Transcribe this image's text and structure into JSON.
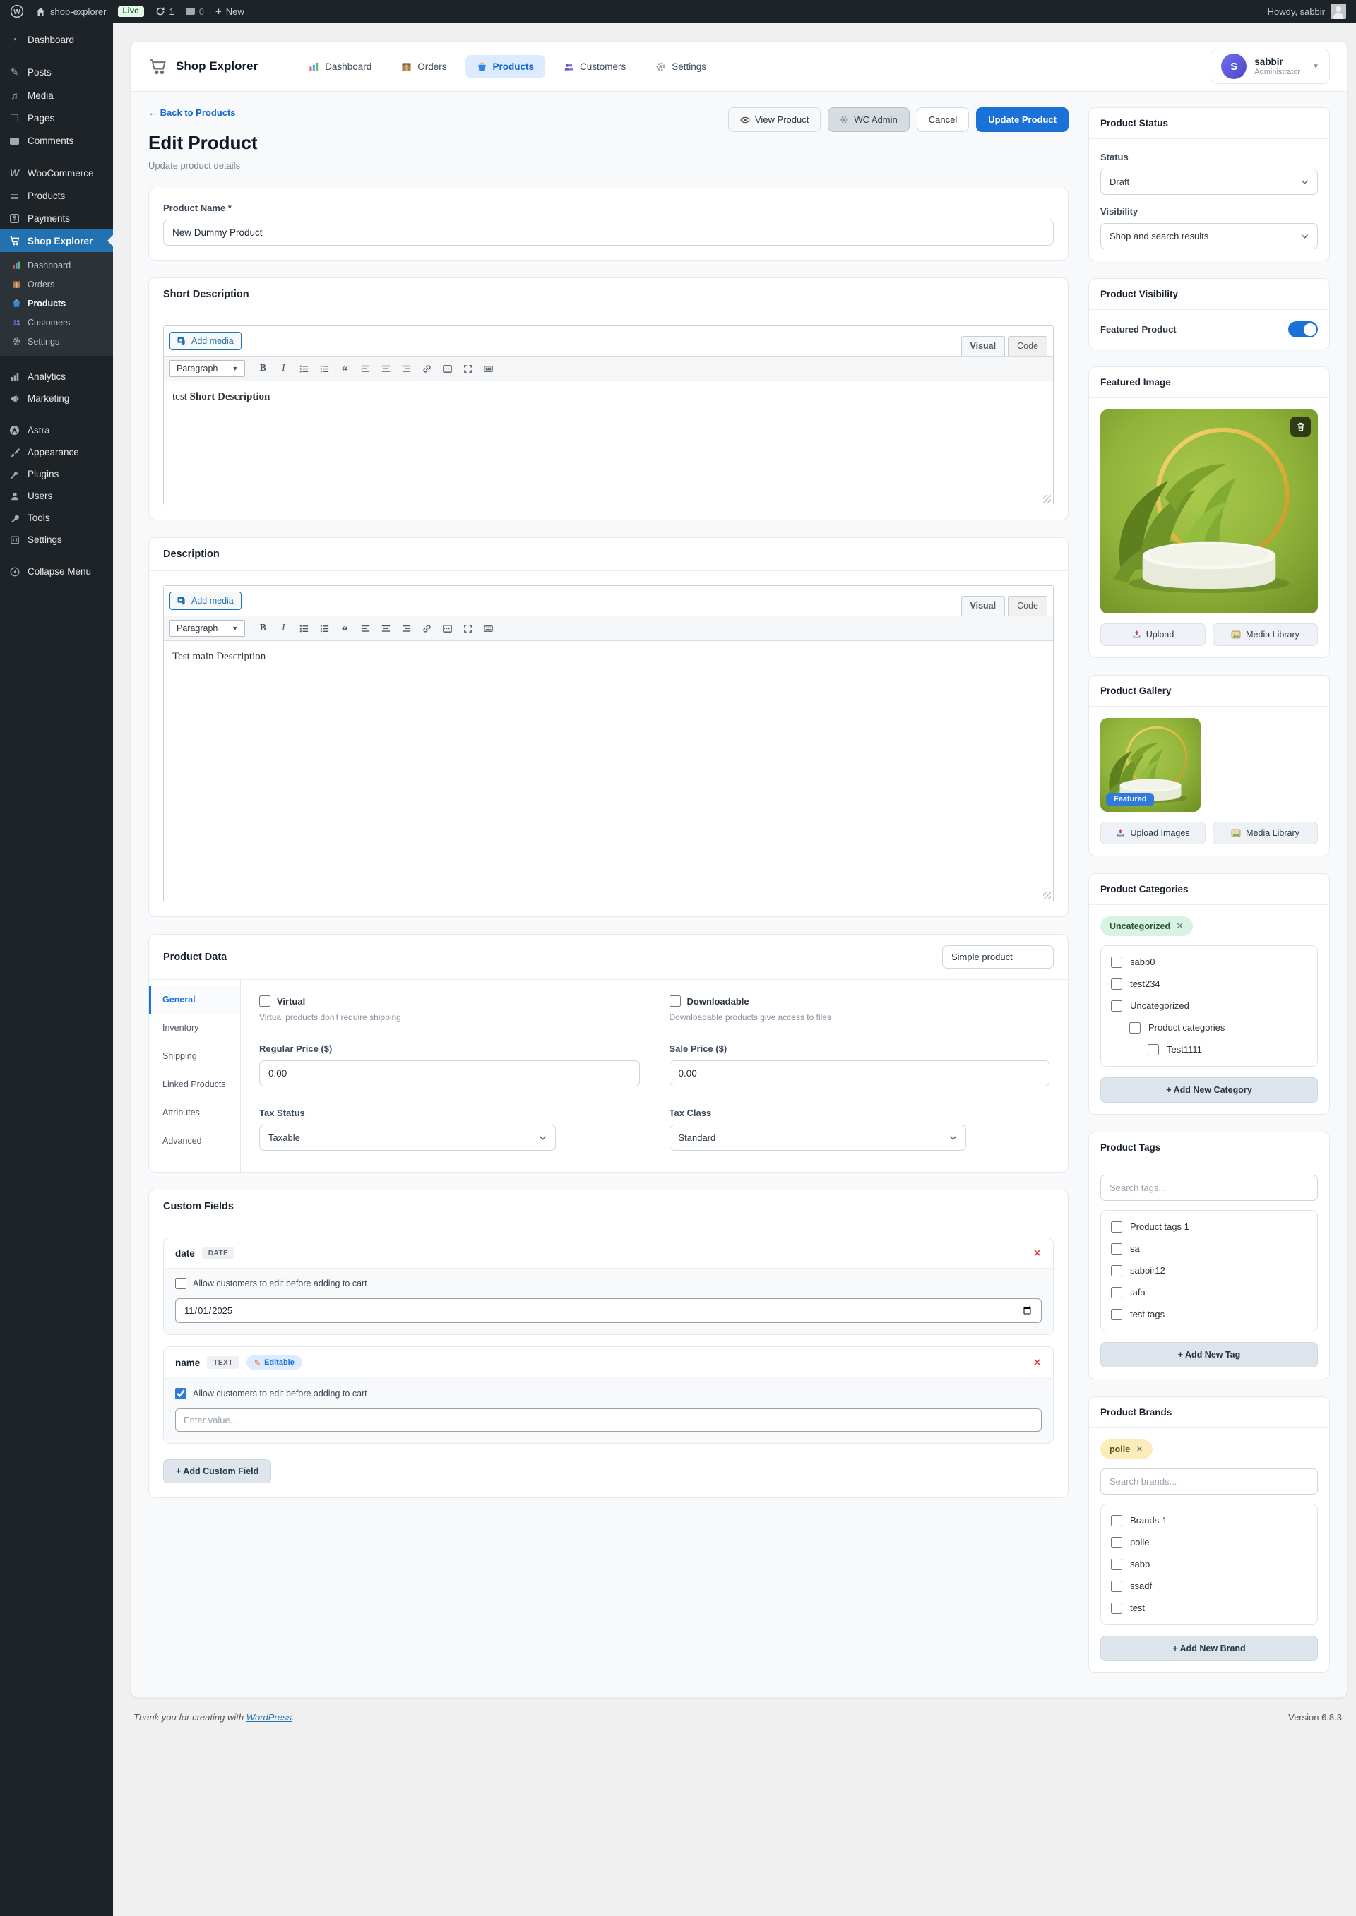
{
  "admin_bar": {
    "site_name": "shop-explorer",
    "live_badge": "Live",
    "update_count": "1",
    "comment_count": "0",
    "new_label": "New",
    "howdy": "Howdy, sabbir"
  },
  "sidebar": {
    "items": [
      {
        "label": "Dashboard"
      },
      {
        "label": "Posts"
      },
      {
        "label": "Media"
      },
      {
        "label": "Pages"
      },
      {
        "label": "Comments"
      },
      {
        "label": "WooCommerce"
      },
      {
        "label": "Products"
      },
      {
        "label": "Payments"
      },
      {
        "label": "Shop Explorer"
      }
    ],
    "submenu": [
      {
        "label": "Dashboard"
      },
      {
        "label": "Orders"
      },
      {
        "label": "Products"
      },
      {
        "label": "Customers"
      },
      {
        "label": "Settings"
      }
    ],
    "items_bottom": [
      {
        "label": "Analytics"
      },
      {
        "label": "Marketing"
      },
      {
        "label": "Astra"
      },
      {
        "label": "Appearance"
      },
      {
        "label": "Plugins"
      },
      {
        "label": "Users"
      },
      {
        "label": "Tools"
      },
      {
        "label": "Settings"
      },
      {
        "label": "Collapse Menu"
      }
    ]
  },
  "header": {
    "brand": "Shop Explorer",
    "nav": [
      {
        "label": "Dashboard"
      },
      {
        "label": "Orders"
      },
      {
        "label": "Products"
      },
      {
        "label": "Customers"
      },
      {
        "label": "Settings"
      }
    ],
    "user": {
      "name": "sabbir",
      "role": "Administrator",
      "avatar_initial": "S"
    }
  },
  "page": {
    "back_link": "← Back to Products",
    "title": "Edit Product",
    "subtitle": "Update product details",
    "actions": {
      "view": "View Product",
      "wc_admin": "WC Admin",
      "cancel": "Cancel",
      "update": "Update Product"
    }
  },
  "form": {
    "product_name": {
      "label": "Product Name *",
      "value": "New Dummy Product"
    },
    "editor": {
      "add_media": "Add media",
      "visual_tab": "Visual",
      "code_tab": "Code",
      "paragraph": "Paragraph"
    },
    "short_description": {
      "title": "Short Description",
      "content_normal": "test ",
      "content_bold": "Short Description"
    },
    "description": {
      "title": "Description",
      "content": "Test main Description"
    },
    "product_data": {
      "title": "Product Data",
      "product_type": "Simple product",
      "tabs": {
        "general": "General",
        "inventory": "Inventory",
        "shipping": "Shipping",
        "linked": "Linked Products",
        "attributes": "Attributes",
        "advanced": "Advanced"
      },
      "virtual_label": "Virtual",
      "virtual_help": "Virtual products don't require shipping",
      "downloadable_label": "Downloadable",
      "downloadable_help": "Downloadable products give access to files",
      "regular_price_label": "Regular Price ($)",
      "regular_price_value": "0.00",
      "sale_price_label": "Sale Price ($)",
      "sale_price_value": "0.00",
      "tax_status_label": "Tax Status",
      "tax_status_value": "Taxable",
      "tax_class_label": "Tax Class",
      "tax_class_value": "Standard"
    },
    "custom_fields": {
      "title": "Custom Fields",
      "allow_label": "Allow customers to edit before adding to cart",
      "field1": {
        "name": "date",
        "type": "DATE",
        "value": "2025-11-01"
      },
      "field2": {
        "name": "name",
        "type": "TEXT",
        "editable_badge": "Editable",
        "placeholder": "Enter value...",
        "checked": "checked"
      },
      "add_button": "+ Add Custom Field"
    }
  },
  "panels": {
    "status": {
      "title": "Product Status",
      "status_label": "Status",
      "status_value": "Draft",
      "visibility_label": "Visibility",
      "visibility_value": "Shop and search results"
    },
    "visibility": {
      "title": "Product Visibility",
      "featured_label": "Featured Product"
    },
    "featured_image": {
      "title": "Featured Image",
      "upload": "Upload",
      "media_library": "Media Library"
    },
    "gallery": {
      "title": "Product Gallery",
      "featured_badge": "Featured",
      "upload": "Upload Images",
      "media_library": "Media Library"
    },
    "categories": {
      "title": "Product Categories",
      "chip": "Uncategorized",
      "items": {
        "0": "sabb0",
        "1": "test234",
        "2": "Uncategorized",
        "3": "Product categories",
        "4": "Test1111"
      },
      "add": "+ Add New Category"
    },
    "tags": {
      "title": "Product Tags",
      "search_placeholder": "Search tags...",
      "items": {
        "0": "Product tags 1",
        "1": "sa",
        "2": "sabbir12",
        "3": "tafa",
        "4": "test tags"
      },
      "add": "+ Add New Tag"
    },
    "brands": {
      "title": "Product Brands",
      "chip": "polle",
      "search_placeholder": "Search brands...",
      "items": {
        "0": "Brands-1",
        "1": "polle",
        "2": "sabb",
        "3": "ssadf",
        "4": "test"
      },
      "add": "+ Add New Brand"
    }
  },
  "footer": {
    "thanks": "Thank you for creating with",
    "link": "WordPress",
    "period": ".",
    "version": "Version 6.8.3"
  },
  "colors": {
    "accent": "#2271b1",
    "primary": "#1a72d8",
    "sidebar_bg": "#1d2327",
    "active_pill_bg": "#dcebff",
    "chip_green": "#d8f3e1",
    "chip_yellow": "#fbecba"
  }
}
